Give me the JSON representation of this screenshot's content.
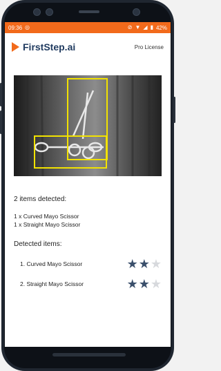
{
  "status_bar": {
    "time": "09:36",
    "left_icon": "whatsapp-icon",
    "right_icons": [
      "mute-icon",
      "wifi-icon",
      "signal-icon"
    ],
    "battery": "42%",
    "color": "#f26a1b"
  },
  "app": {
    "brand": "FirstStep.ai",
    "license": "Pro License",
    "accent": "#f26a1b",
    "brand_color": "#1f3a5f"
  },
  "detection": {
    "count_text": "2 items detected:",
    "summary_lines": [
      "1 x Curved Mayo Scissor",
      "1 x Straight Mayo Scissor"
    ],
    "box_color": "#f2e200"
  },
  "items_section": {
    "title": "Detected items:",
    "items": [
      {
        "label": "1. Curved Mayo Scissor",
        "rating": 2,
        "max": 3
      },
      {
        "label": "2. Straight Mayo Scissor",
        "rating": 2,
        "max": 3
      }
    ]
  }
}
